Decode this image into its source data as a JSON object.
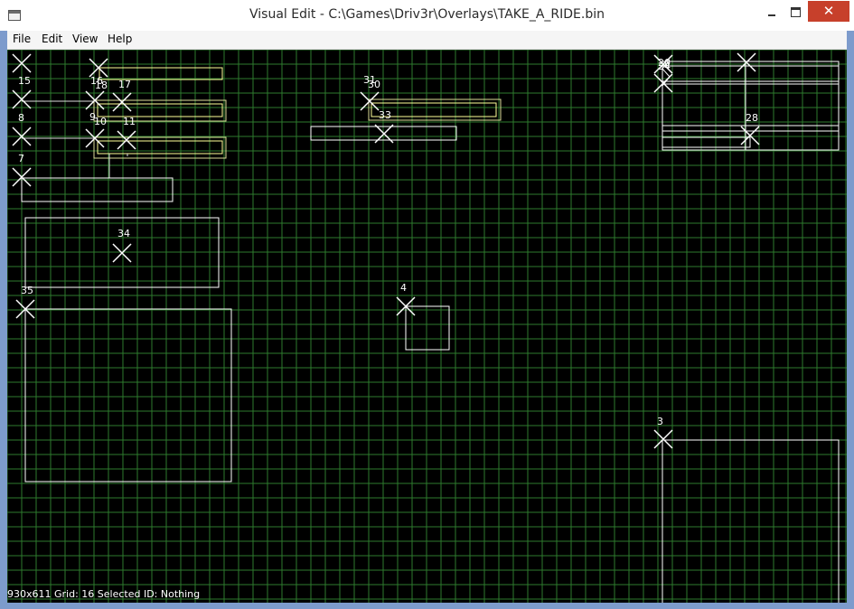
{
  "window": {
    "title": "Visual Edit - C:\\Games\\Driv3r\\Overlays\\TAKE_A_RIDE.bin",
    "close_glyph": "✕"
  },
  "menu": {
    "file": "File",
    "edit": "Edit",
    "view": "View",
    "help": "Help"
  },
  "colors": {
    "grid": "#2e7a2e",
    "element": "#ffffff",
    "highlight": "#ffff99",
    "background": "#000000"
  },
  "grid_size_label": "16",
  "status": "930x611 Grid: 16 Selected ID: Nothing",
  "markers": {
    "m15": "15",
    "m16": "16",
    "m18": "18",
    "m17": "17",
    "m8": "8",
    "m9": "9",
    "m10": "10",
    "m11": "11",
    "m7": "7",
    "m34": "34",
    "m35": "35",
    "m31": "31",
    "m30": "30",
    "m33": "33",
    "m4": "4",
    "m3": "3",
    "m20": "20",
    "m24": "24",
    "m28": "28"
  }
}
